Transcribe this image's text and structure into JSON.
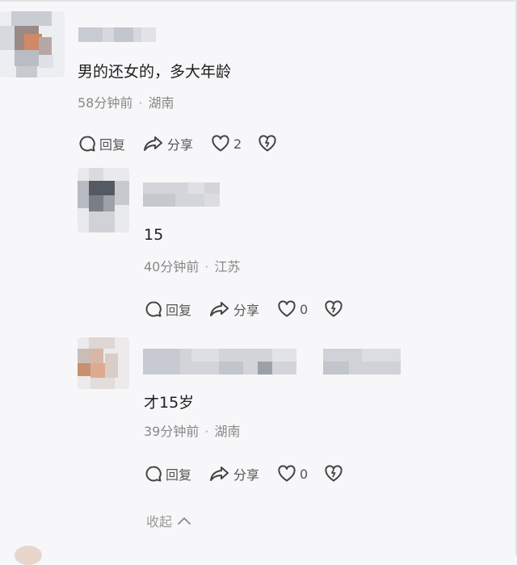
{
  "comments": [
    {
      "text": "男的还女的，多大年龄",
      "time": "58分钟前",
      "location": "湖南",
      "reply_label": "回复",
      "share_label": "分享",
      "like_count": "2"
    },
    {
      "text": "15",
      "time": "40分钟前",
      "location": "江苏",
      "reply_label": "回复",
      "share_label": "分享",
      "like_count": "0"
    },
    {
      "text": "才15岁",
      "time": "39分钟前",
      "location": "湖南",
      "reply_label": "回复",
      "share_label": "分享",
      "like_count": "0"
    }
  ],
  "collapse_label": "收起",
  "icons": {
    "reply": "comment-bubble-icon",
    "share": "share-arrow-icon",
    "like": "heart-icon",
    "dislike": "broken-heart-icon",
    "collapse": "chevron-up-icon"
  },
  "colors": {
    "background": "#f7f7f9",
    "text": "#1e1e1e",
    "meta": "#888888"
  }
}
